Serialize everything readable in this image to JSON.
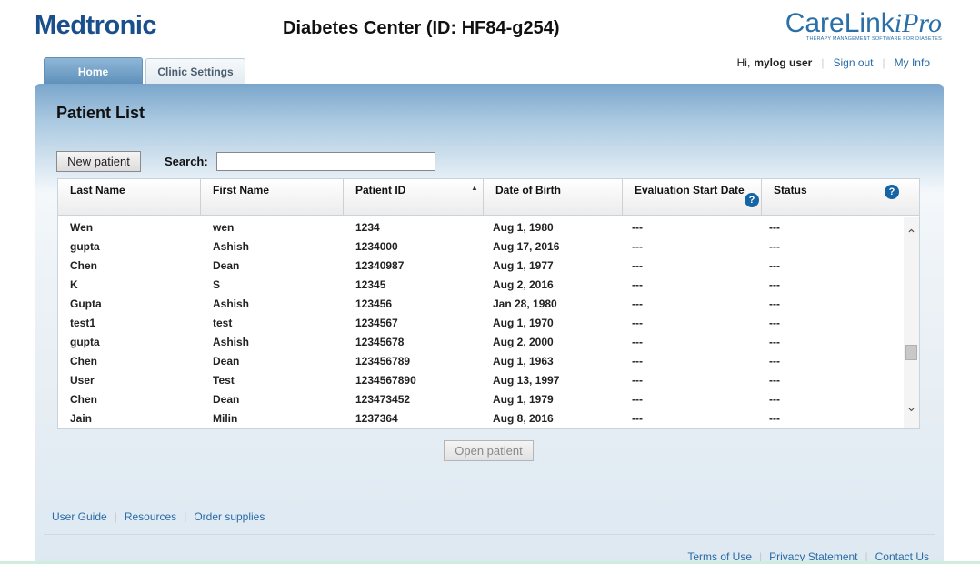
{
  "header": {
    "brand_left": "Medtronic",
    "center_title": "Diabetes Center (ID: HF84-g254)",
    "brand_right": "CareLink",
    "brand_right_suffix": "iPro",
    "brand_right_tagline": "THERAPY MANAGEMENT SOFTWARE FOR DIABETES"
  },
  "user_links": {
    "greeting": "Hi,",
    "username": "mylog user",
    "sign_out": "Sign out",
    "my_info": "My Info"
  },
  "tabs": [
    {
      "label": "Home",
      "active": true
    },
    {
      "label": "Clinic Settings",
      "active": false
    }
  ],
  "patient_list": {
    "title": "Patient List",
    "new_patient_label": "New patient",
    "search_label": "Search:",
    "search_value": "",
    "columns": [
      "Last Name",
      "First Name",
      "Patient ID",
      "Date of Birth",
      "Evaluation Start Date",
      "Status"
    ],
    "rows": [
      [
        "Wen",
        "wen",
        "1234",
        "Aug 1, 1980",
        "---",
        "---"
      ],
      [
        "gupta",
        "Ashish",
        "1234000",
        "Aug 17, 2016",
        "---",
        "---"
      ],
      [
        "Chen",
        "Dean",
        "12340987",
        "Aug 1, 1977",
        "---",
        "---"
      ],
      [
        "K",
        "S",
        "12345",
        "Aug 2, 2016",
        "---",
        "---"
      ],
      [
        "Gupta",
        "Ashish",
        "123456",
        "Jan 28, 1980",
        "---",
        "---"
      ],
      [
        "test1",
        "test",
        "1234567",
        "Aug 1, 1970",
        "---",
        "---"
      ],
      [
        "gupta",
        "Ashish",
        "12345678",
        "Aug 2, 2000",
        "---",
        "---"
      ],
      [
        "Chen",
        "Dean",
        "123456789",
        "Aug 1, 1963",
        "---",
        "---"
      ],
      [
        "User",
        "Test",
        "1234567890",
        "Aug 13, 1997",
        "---",
        "---"
      ],
      [
        "Chen",
        "Dean",
        "123473452",
        "Aug 1, 1979",
        "---",
        "---"
      ],
      [
        "Jain",
        "Milin",
        "1237364",
        "Aug 8, 2016",
        "---",
        "---"
      ]
    ],
    "open_patient_label": "Open patient",
    "help_glyph": "?"
  },
  "bottom_links": [
    "User Guide",
    "Resources",
    "Order supplies"
  ],
  "footer_links": [
    "Terms of Use",
    "Privacy Statement",
    "Contact Us"
  ],
  "colors": {
    "brand_blue": "#1a4f8b",
    "link_blue": "#2a6aa6",
    "accent_rule": "#e0a020",
    "help_icon": "#1565a6"
  }
}
